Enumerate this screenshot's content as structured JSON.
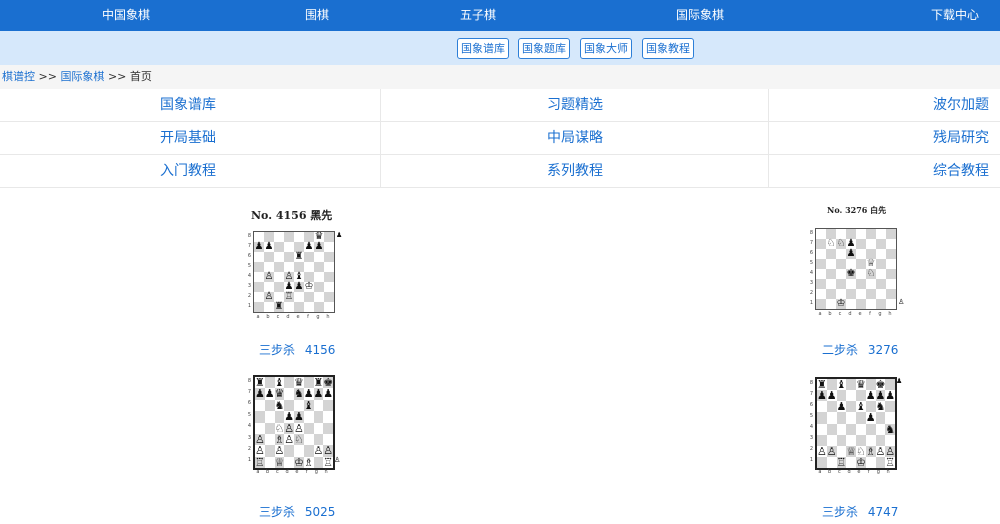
{
  "topnav": [
    "中国象棋",
    "围棋",
    "五子棋",
    "国际象棋",
    "下载中心"
  ],
  "subnav": [
    "国象谱库",
    "国象题库",
    "国象大师",
    "国象教程"
  ],
  "breadcrumb": {
    "root": "棋谱控",
    "sep1": ">>",
    "section": "国际象棋",
    "sep2": ">>",
    "current": "首页"
  },
  "categories": [
    [
      "国象谱库",
      "习题精选",
      "波尔加题"
    ],
    [
      "开局基础",
      "中局谋略",
      "残局研究"
    ],
    [
      "入门教程",
      "系列教程",
      "综合教程"
    ]
  ],
  "puzzles": [
    {
      "title": "No. 4156   黑先",
      "caption": "三步杀 4156"
    },
    {
      "title": "No. 3276  白先",
      "caption": "二步杀 3276"
    },
    {
      "title": "",
      "caption": "三步杀 5025"
    },
    {
      "title": "",
      "caption": "三步杀 4747"
    }
  ],
  "board_labels": {
    "files": [
      "a",
      "b",
      "c",
      "d",
      "e",
      "f",
      "g",
      "h"
    ],
    "ranks": [
      "8",
      "7",
      "6",
      "5",
      "4",
      "3",
      "2",
      "1"
    ]
  },
  "boards": [
    {
      "turn": "black",
      "pieces": [
        [
          "g8",
          "♛"
        ],
        [
          "a7",
          "♟"
        ],
        [
          "b7",
          "♟"
        ],
        [
          "f7",
          "♟"
        ],
        [
          "g7",
          "♟"
        ],
        [
          "e6",
          "♜"
        ],
        [
          "b4",
          "♙"
        ],
        [
          "d4",
          "♙"
        ],
        [
          "e4",
          "♝"
        ],
        [
          "d3",
          "♟"
        ],
        [
          "e3",
          "♟"
        ],
        [
          "f3",
          "♔"
        ],
        [
          "b2",
          "♙"
        ],
        [
          "d2",
          "♖"
        ],
        [
          "c1",
          "♜"
        ]
      ]
    },
    {
      "turn": "white",
      "pieces": [
        [
          "b7",
          "♘"
        ],
        [
          "c7",
          "♘"
        ],
        [
          "d7",
          "♟"
        ],
        [
          "d6",
          "♟"
        ],
        [
          "f5",
          "♕"
        ],
        [
          "d4",
          "♚"
        ],
        [
          "f4",
          "♘"
        ],
        [
          "c1",
          "♔"
        ]
      ]
    },
    {
      "turn": "white",
      "pieces": [
        [
          "a8",
          "♜"
        ],
        [
          "c8",
          "♝"
        ],
        [
          "e8",
          "♛"
        ],
        [
          "g8",
          "♜"
        ],
        [
          "h8",
          "♚"
        ],
        [
          "a7",
          "♟"
        ],
        [
          "b7",
          "♟"
        ],
        [
          "c7",
          "♛"
        ],
        [
          "e7",
          "♞"
        ],
        [
          "f7",
          "♟"
        ],
        [
          "g7",
          "♟"
        ],
        [
          "h7",
          "♟"
        ],
        [
          "c6",
          "♞"
        ],
        [
          "f6",
          "♝"
        ],
        [
          "d5",
          "♟"
        ],
        [
          "e5",
          "♟"
        ],
        [
          "c4",
          "♘"
        ],
        [
          "d4",
          "♙"
        ],
        [
          "e4",
          "♙"
        ],
        [
          "a3",
          "♙"
        ],
        [
          "c3",
          "♗"
        ],
        [
          "d3",
          "♙"
        ],
        [
          "e3",
          "♘"
        ],
        [
          "a2",
          "♙"
        ],
        [
          "c2",
          "♙"
        ],
        [
          "g2",
          "♙"
        ],
        [
          "h2",
          "♙"
        ],
        [
          "a1",
          "♖"
        ],
        [
          "c1",
          "♕"
        ],
        [
          "e1",
          "♔"
        ],
        [
          "f1",
          "♗"
        ],
        [
          "h1",
          "♖"
        ]
      ]
    },
    {
      "turn": "black",
      "pieces": [
        [
          "a8",
          "♜"
        ],
        [
          "c8",
          "♝"
        ],
        [
          "e8",
          "♛"
        ],
        [
          "g8",
          "♚"
        ],
        [
          "a7",
          "♟"
        ],
        [
          "b7",
          "♟"
        ],
        [
          "f7",
          "♟"
        ],
        [
          "g7",
          "♟"
        ],
        [
          "h7",
          "♟"
        ],
        [
          "c6",
          "♟"
        ],
        [
          "e6",
          "♝"
        ],
        [
          "g6",
          "♞"
        ],
        [
          "f5",
          "♟"
        ],
        [
          "h4",
          "♞"
        ],
        [
          "a2",
          "♙"
        ],
        [
          "b2",
          "♙"
        ],
        [
          "d2",
          "♕"
        ],
        [
          "e2",
          "♘"
        ],
        [
          "f2",
          "♗"
        ],
        [
          "g2",
          "♙"
        ],
        [
          "h2",
          "♙"
        ],
        [
          "c1",
          "♖"
        ],
        [
          "e1",
          "♔"
        ],
        [
          "h1",
          "♖"
        ]
      ]
    }
  ]
}
